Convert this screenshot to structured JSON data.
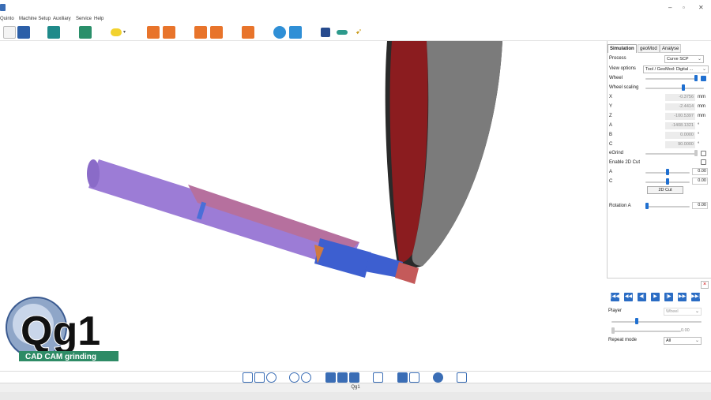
{
  "window": {
    "minimize": "–",
    "restore": "▫",
    "close": "✕"
  },
  "menu": [
    "Quinto",
    "Machine Setup",
    "Auxiliary",
    "Service",
    "Help"
  ],
  "toolbar": {
    "icons": [
      "save-icon",
      "table-icon",
      "grinding-machine-icon",
      "wheel-setup-icon",
      "cloud-dropdown-icon",
      "sample-icon",
      "tool-edit-icon",
      "rotate-icon",
      "program-icon",
      "grid-icon",
      "target-icon",
      "profile-icon",
      "wheelpack-icon",
      "cylinder-icon",
      "arrow-icon"
    ]
  },
  "panel": {
    "tabs": [
      "Simulation",
      "geoMod",
      "Analyse"
    ],
    "process_label": "Process",
    "process_value": "Curve SCP",
    "view_options_label": "View options",
    "view_options_value": "Tool / GeoMod: Digital ...",
    "wheel_label": "Wheel",
    "wheel_scaling_label": "Wheel scaling",
    "axes": [
      {
        "label": "X",
        "value": "-0.3756",
        "unit": "mm"
      },
      {
        "label": "Y",
        "value": "-2.4414",
        "unit": "mm"
      },
      {
        "label": "Z",
        "value": "-100.5397",
        "unit": "mm"
      },
      {
        "label": "A",
        "value": "-1408.1321",
        "unit": "°"
      },
      {
        "label": "B",
        "value": "0.0000",
        "unit": "°"
      },
      {
        "label": "C",
        "value": "90.0000",
        "unit": "°"
      }
    ],
    "egrind_label": "eGrind",
    "enable_2d_label": "Enable 2D Cut",
    "cut_a_label": "A",
    "cut_a_value": "0.00",
    "cut_c_label": "C",
    "cut_c_value": "0.00",
    "cut_button": "2D Cut",
    "rotation_label": "Rotation A",
    "rotation_value": "0.00"
  },
  "player": {
    "close": "×",
    "buttons": [
      "|◀◀",
      "◀◀",
      "◀|",
      "▶",
      "|▶",
      "▶▶",
      "▶▶|"
    ],
    "player_label": "Player",
    "player_value": "Wheel",
    "position_value": "0.00",
    "repeat_label": "Repeat mode",
    "repeat_value": "All"
  },
  "logo": {
    "text": "Qg1",
    "subtitle": "CAD CAM grinding"
  },
  "status": {
    "text": "Qg1"
  },
  "colors": {
    "accent": "#1f6fd0",
    "tool_body": "#9c7cd6",
    "wheel_red": "#8b1c1f",
    "wheel_gray": "#7b7b7b"
  }
}
